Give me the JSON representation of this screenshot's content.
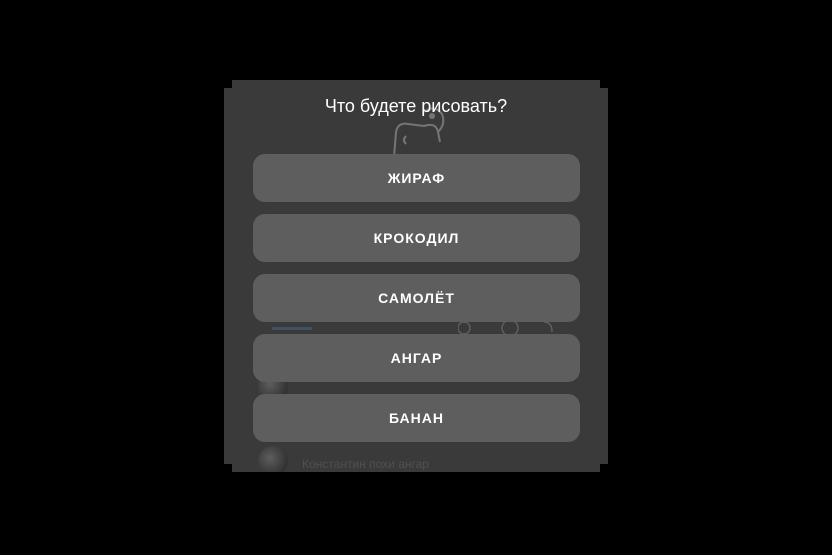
{
  "dialog": {
    "title": "Что будете рисовать?",
    "options": [
      {
        "label": "ЖИРАФ"
      },
      {
        "label": "КРОКОДИЛ"
      },
      {
        "label": "САМОЛЁТ"
      },
      {
        "label": "АНГАР"
      },
      {
        "label": "БАНАН"
      }
    ]
  },
  "background": {
    "chat_text": "Константин похи ангар"
  },
  "colors": {
    "overlay": "#3a3a3a",
    "button": "#5e5e5e",
    "text": "#ffffff"
  }
}
